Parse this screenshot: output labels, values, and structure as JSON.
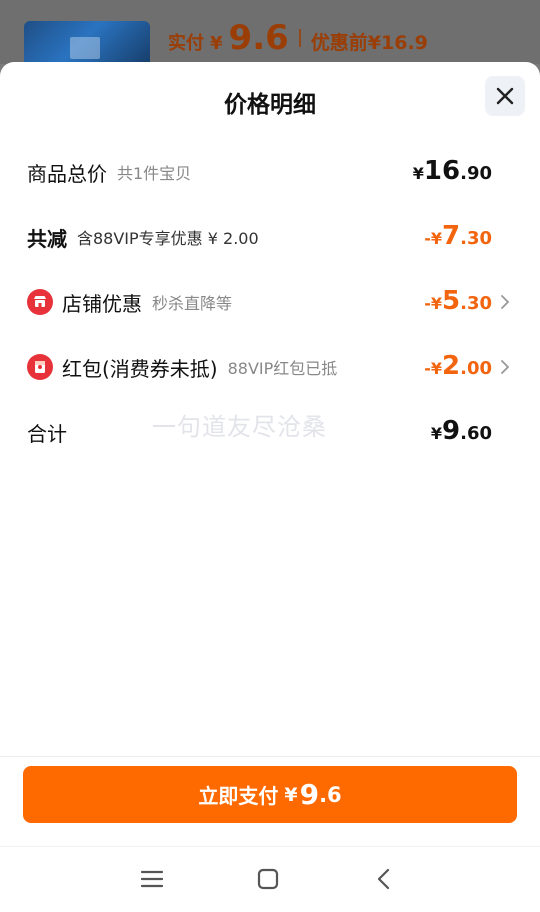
{
  "top_bar": {
    "paid_label": "实付",
    "currency": "¥",
    "paid_amount": "9.6",
    "before_label": "优惠前",
    "before_amount": "¥16.9"
  },
  "sheet": {
    "title": "价格明细",
    "close_icon": "close-icon",
    "rows": [
      {
        "label": "商品总价",
        "sub": "共1件宝贝",
        "currency": "¥",
        "int": "16",
        "dec": ".90"
      },
      {
        "label": "共减",
        "sub": "含88VIP专享优惠 ¥ 2.00",
        "currency": "-¥",
        "int": "7",
        "dec": ".30"
      },
      {
        "label": "店铺优惠",
        "sub": "秒杀直降等",
        "icon": "store-icon",
        "currency": "-¥",
        "int": "5",
        "dec": ".30",
        "chevron": "chevron-right-icon"
      },
      {
        "label": "红包(消费券未抵)",
        "sub": "88VIP红包已抵",
        "icon": "red-packet-icon",
        "currency": "-¥",
        "int": "2",
        "dec": ".00",
        "chevron": "chevron-right-icon"
      },
      {
        "label": "合计",
        "currency": "¥",
        "int": "9",
        "dec": ".60"
      }
    ],
    "watermark": "一句道友尽沧桑"
  },
  "pay_button": {
    "label": "立即支付",
    "currency": "¥",
    "int": "9",
    "dec": ".6"
  },
  "navbar": {
    "menu_icon": "menu-icon",
    "home_icon": "home-icon",
    "back_icon": "back-icon"
  },
  "colors": {
    "accent": "#ff6a00",
    "discount": "#f2640d",
    "badge": "#e8323a"
  }
}
